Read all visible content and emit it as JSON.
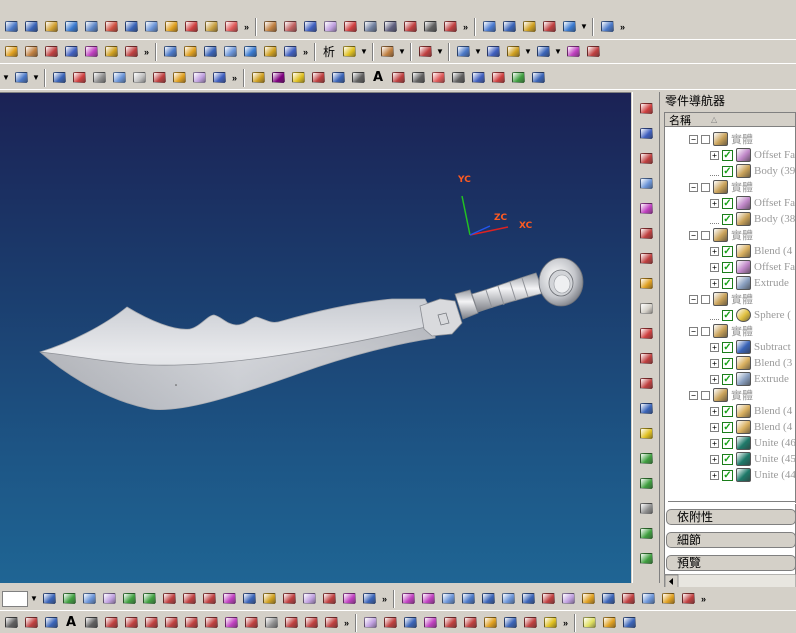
{
  "toolbars": {
    "row1": [
      {
        "name": "solid-box-icon",
        "color": "#4a78c8"
      },
      {
        "name": "cylinder-icon",
        "color": "#3a64b8"
      },
      {
        "name": "cone-icon",
        "color": "#d2a030"
      },
      {
        "name": "sphere-icon",
        "color": "#3a7ad0"
      },
      {
        "name": "block-icon",
        "color": "#5c86c8"
      },
      {
        "name": "extrude-icon",
        "color": "#d05040"
      },
      {
        "name": "revolve-icon",
        "color": "#3a64b8"
      },
      {
        "name": "sweep-icon",
        "color": "#6a94d8"
      },
      {
        "name": "tube-icon",
        "color": "#e0a020"
      },
      {
        "name": "hole-icon",
        "color": "#d04040"
      },
      {
        "name": "boss-icon",
        "color": "#c8a040"
      },
      {
        "name": "pocket-icon",
        "color": "#e05858"
      },
      {
        "name": "more-icon",
        "kind": "more"
      },
      {
        "name": "sep",
        "kind": "sep"
      },
      {
        "name": "blend-icon",
        "color": "#c08040"
      },
      {
        "name": "chamfer-icon",
        "color": "#c06060"
      },
      {
        "name": "shell-icon",
        "color": "#4060c0"
      },
      {
        "name": "offset-face-icon",
        "color": "#c0a0e0"
      },
      {
        "name": "draft-icon",
        "color": "#d04040"
      },
      {
        "name": "curve-icon",
        "color": "#7080a0"
      },
      {
        "name": "spline-icon",
        "color": "#606080"
      },
      {
        "name": "line-icon",
        "color": "#c04040"
      },
      {
        "name": "arc-icon",
        "color": "#606060"
      },
      {
        "name": "trim-icon",
        "color": "#c04040"
      },
      {
        "name": "more-icon",
        "kind": "more"
      },
      {
        "name": "sep",
        "kind": "sep"
      },
      {
        "name": "view-fit-icon",
        "color": "#4a7ad0"
      },
      {
        "name": "zoom-icon",
        "color": "#3a64b8"
      },
      {
        "name": "rotate-icon",
        "color": "#d0a020"
      },
      {
        "name": "pan-icon",
        "color": "#c04040"
      },
      {
        "name": "shaded-icon",
        "color": "#3a7ad0"
      },
      {
        "name": "dropdown",
        "kind": "drop"
      },
      {
        "name": "sep",
        "kind": "sep"
      },
      {
        "name": "analysis-icon",
        "color": "#4a78c8"
      },
      {
        "name": "more-icon",
        "kind": "more"
      }
    ],
    "row2": [
      {
        "name": "point-icon",
        "color": "#e0a020"
      },
      {
        "name": "plane-icon",
        "color": "#c08040"
      },
      {
        "name": "axis-icon",
        "color": "#c04040"
      },
      {
        "name": "csys-icon",
        "color": "#4060c0"
      },
      {
        "name": "sketch-icon",
        "color": "#c040c0"
      },
      {
        "name": "pattern-icon",
        "color": "#d0a020"
      },
      {
        "name": "mirror-icon",
        "color": "#c04040"
      },
      {
        "name": "more-icon",
        "kind": "more"
      },
      {
        "name": "sep",
        "kind": "sep"
      },
      {
        "name": "edit-feature-icon",
        "color": "#4a78c8"
      },
      {
        "name": "edit-param-icon",
        "color": "#e0a020"
      },
      {
        "name": "move-icon",
        "color": "#3a64b8"
      },
      {
        "name": "replace-icon",
        "color": "#6a94d8"
      },
      {
        "name": "suppress-icon",
        "color": "#3a7ad0"
      },
      {
        "name": "unsuppress-icon",
        "color": "#d0a020"
      },
      {
        "name": "reorder-icon",
        "color": "#4060c0"
      },
      {
        "name": "more-icon",
        "kind": "more"
      },
      {
        "name": "sep",
        "kind": "sep"
      },
      {
        "name": "analysis-label",
        "kind": "label",
        "bind": "toolbars.row2_label"
      },
      {
        "name": "measure-icon",
        "color": "#e0c020"
      },
      {
        "name": "dropdown",
        "kind": "drop"
      },
      {
        "name": "sep",
        "kind": "sep"
      },
      {
        "name": "section-icon",
        "color": "#c08040"
      },
      {
        "name": "dropdown",
        "kind": "drop"
      },
      {
        "name": "sep",
        "kind": "sep"
      },
      {
        "name": "layer-icon",
        "color": "#c04040"
      },
      {
        "name": "dropdown",
        "kind": "drop"
      },
      {
        "name": "sep",
        "kind": "sep"
      },
      {
        "name": "wcs-icon",
        "color": "#4a78c8"
      },
      {
        "name": "dropdown",
        "kind": "drop"
      },
      {
        "name": "grid-icon",
        "color": "#4060c0"
      },
      {
        "name": "snap-icon",
        "color": "#d0a020"
      },
      {
        "name": "dropdown",
        "kind": "drop"
      },
      {
        "name": "view-icon",
        "color": "#3a64b8"
      },
      {
        "name": "dropdown",
        "kind": "drop"
      },
      {
        "name": "orient-icon",
        "color": "#c040c0"
      },
      {
        "name": "select-icon",
        "color": "#c04040"
      }
    ],
    "row2_label": "析",
    "row3": [
      {
        "name": "dropdown",
        "kind": "drop"
      },
      {
        "name": "feature-icon",
        "color": "#4a78c8"
      },
      {
        "name": "dropdown",
        "kind": "drop"
      },
      {
        "name": "sep",
        "kind": "sep"
      },
      {
        "name": "library-icon",
        "color": "#3a64b8"
      },
      {
        "name": "part-icon",
        "color": "#d04040"
      },
      {
        "name": "gear-icon",
        "color": "#909090"
      },
      {
        "name": "template-icon",
        "color": "#6a94d8"
      },
      {
        "name": "sheet-icon",
        "color": "#c0c0c0"
      },
      {
        "name": "assembly-icon",
        "color": "#c04040"
      },
      {
        "name": "surface-icon",
        "color": "#e0a020"
      },
      {
        "name": "mesh-icon",
        "color": "#c0a0e0"
      },
      {
        "name": "render-icon",
        "color": "#4060c0"
      },
      {
        "name": "more-icon",
        "kind": "more"
      },
      {
        "name": "sep",
        "kind": "sep"
      },
      {
        "name": "dialog-icon",
        "color": "#d0a020"
      },
      {
        "name": "stop-icon",
        "color": "#800080"
      },
      {
        "name": "warning-icon",
        "color": "#e0c020"
      },
      {
        "name": "publish-icon",
        "color": "#c04040"
      },
      {
        "name": "data-icon",
        "color": "#3a64b8"
      },
      {
        "name": "param-icon",
        "color": "#606060"
      },
      {
        "name": "text-a-icon",
        "kind": "text",
        "bind": "toolbars.row3_text"
      },
      {
        "name": "text-style-icon",
        "color": "#c04040"
      },
      {
        "name": "dimension-icon",
        "color": "#606060"
      },
      {
        "name": "note-icon",
        "color": "#e05858"
      },
      {
        "name": "label-icon",
        "color": "#606060"
      },
      {
        "name": "table-icon",
        "color": "#4060c0"
      },
      {
        "name": "check-icon",
        "color": "#d04040"
      },
      {
        "name": "image-icon",
        "color": "#40a040"
      },
      {
        "name": "check2-icon",
        "color": "#3a64b8"
      }
    ],
    "row3_text": "A"
  },
  "viewport": {
    "background_top": "#1b2255",
    "background_bottom": "#1f6594",
    "axis_labels": {
      "y": "YC",
      "z": "ZC",
      "x": "XC"
    }
  },
  "resource_bar": [
    {
      "name": "sketch-resource-icon",
      "color": "#d04040"
    },
    {
      "name": "datum-resource-icon",
      "color": "#4060c0"
    },
    {
      "name": "pmi-resource-icon",
      "color": "#c04040"
    },
    {
      "name": "blend-resource-icon",
      "color": "#6a94d8"
    },
    {
      "name": "curve-resource-icon",
      "color": "#c040c0"
    },
    {
      "name": "table-resource-icon",
      "color": "#c04040"
    },
    {
      "name": "feature-resource-icon",
      "color": "#c04040"
    },
    {
      "name": "palette-resource-icon",
      "color": "#e0a020"
    },
    {
      "name": "blank-resource-icon",
      "color": "#d4d0c8"
    },
    {
      "name": "roles-resource-icon",
      "color": "#d04040"
    },
    {
      "name": "history-resource-icon",
      "color": "#c04040"
    },
    {
      "name": "constraint-resource-icon",
      "color": "#c04040"
    },
    {
      "name": "web-resource-icon",
      "color": "#3a64b8"
    },
    {
      "name": "reuse-resource-icon",
      "color": "#e0c020"
    },
    {
      "name": "library-resource-icon",
      "color": "#40a040"
    },
    {
      "name": "system-resource-icon",
      "color": "#40a040"
    },
    {
      "name": "print-resource-icon",
      "color": "#909090"
    },
    {
      "name": "back-resource-icon",
      "color": "#40a040"
    },
    {
      "name": "forward-resource-icon",
      "color": "#40a040"
    }
  ],
  "navigator": {
    "title": "零件導航器",
    "column_name": "名稱",
    "sort_glyph": "△",
    "rows": [
      {
        "level": 0,
        "expander": "−",
        "checkbox": "empty",
        "icon": "solid",
        "label": "實體"
      },
      {
        "level": 1,
        "expander": "+",
        "checkbox": "check",
        "icon": "offset",
        "label": "Offset Fa"
      },
      {
        "level": 1,
        "expander": "line",
        "checkbox": "check",
        "icon": "body",
        "label": "Body (39"
      },
      {
        "level": 0,
        "expander": "−",
        "checkbox": "empty",
        "icon": "solid",
        "label": "實體"
      },
      {
        "level": 1,
        "expander": "+",
        "checkbox": "check",
        "icon": "offset",
        "label": "Offset Fa"
      },
      {
        "level": 1,
        "expander": "line",
        "checkbox": "check",
        "icon": "body",
        "label": "Body (38"
      },
      {
        "level": 0,
        "expander": "−",
        "checkbox": "empty",
        "icon": "solid",
        "label": "實體"
      },
      {
        "level": 1,
        "expander": "+",
        "checkbox": "check",
        "icon": "blend",
        "label": "Blend (4"
      },
      {
        "level": 1,
        "expander": "+",
        "checkbox": "check",
        "icon": "offset",
        "label": "Offset Fa"
      },
      {
        "level": 1,
        "expander": "+",
        "checkbox": "check",
        "icon": "extrude",
        "label": "Extrude"
      },
      {
        "level": 0,
        "expander": "−",
        "checkbox": "empty",
        "icon": "solid",
        "label": "實體"
      },
      {
        "level": 1,
        "expander": "line",
        "checkbox": "check",
        "icon": "sphere",
        "label": "Sphere ("
      },
      {
        "level": 0,
        "expander": "−",
        "checkbox": "empty",
        "icon": "solid",
        "label": "實體"
      },
      {
        "level": 1,
        "expander": "+",
        "checkbox": "check",
        "icon": "subtract",
        "label": "Subtract"
      },
      {
        "level": 1,
        "expander": "+",
        "checkbox": "check",
        "icon": "blend",
        "label": "Blend (3"
      },
      {
        "level": 1,
        "expander": "+",
        "checkbox": "check",
        "icon": "extrude",
        "label": "Extrude"
      },
      {
        "level": 0,
        "expander": "−",
        "checkbox": "empty",
        "icon": "solid",
        "label": "實體"
      },
      {
        "level": 1,
        "expander": "+",
        "checkbox": "check",
        "icon": "blend",
        "label": "Blend (4"
      },
      {
        "level": 1,
        "expander": "+",
        "checkbox": "check",
        "icon": "blend",
        "label": "Blend (4"
      },
      {
        "level": 1,
        "expander": "+",
        "checkbox": "check",
        "icon": "unite",
        "label": "Unite (46"
      },
      {
        "level": 1,
        "expander": "+",
        "checkbox": "check",
        "icon": "unite",
        "label": "Unite (45"
      },
      {
        "level": 1,
        "expander": "+",
        "checkbox": "check",
        "icon": "unite",
        "label": "Unite (44"
      }
    ],
    "panels": [
      {
        "name": "dependencies-panel",
        "label": "依附性"
      },
      {
        "name": "details-panel",
        "label": "細節"
      },
      {
        "name": "preview-panel",
        "label": "預覽"
      }
    ]
  },
  "bottom_bar1": [
    {
      "name": "layer-select-dropdown",
      "kind": "drop"
    },
    {
      "name": "copy-icon",
      "color": "#3a64b8"
    },
    {
      "name": "layer-settings-icon",
      "color": "#40a040"
    },
    {
      "name": "visible-icon",
      "color": "#6a94d8"
    },
    {
      "name": "move-layer-icon",
      "color": "#c0a0e0"
    },
    {
      "name": "prev-icon",
      "color": "#40a040"
    },
    {
      "name": "next-icon",
      "color": "#40a040"
    },
    {
      "name": "select-filter-icon",
      "color": "#c04040"
    },
    {
      "name": "snap-point-icon",
      "color": "#c04040"
    },
    {
      "name": "snap-end-icon",
      "color": "#c04040"
    },
    {
      "name": "snap-mid-icon",
      "color": "#c040c0"
    },
    {
      "name": "snap-center-icon",
      "color": "#3a64b8"
    },
    {
      "name": "snap-quad-icon",
      "color": "#d0a020"
    },
    {
      "name": "snap-intersect-icon",
      "color": "#c04040"
    },
    {
      "name": "snap-face-icon",
      "color": "#c0a0e0"
    },
    {
      "name": "snap-curve-icon",
      "color": "#c04040"
    },
    {
      "name": "snap-existing-icon",
      "color": "#c040c0"
    },
    {
      "name": "snap-tangent-icon",
      "color": "#3a64b8"
    },
    {
      "name": "more-icon",
      "kind": "more"
    },
    {
      "name": "sep",
      "kind": "sep"
    },
    {
      "name": "wire-icon",
      "color": "#c040c0"
    },
    {
      "name": "hidden-icon",
      "color": "#c040c0"
    },
    {
      "name": "edge-icon",
      "color": "#6a94d8"
    },
    {
      "name": "face-icon",
      "color": "#4a78c8"
    },
    {
      "name": "face-analysis-icon",
      "color": "#3a64b8"
    },
    {
      "name": "smooth-icon",
      "color": "#6a94d8"
    },
    {
      "name": "partial-icon",
      "color": "#3a64b8"
    },
    {
      "name": "studio-icon",
      "color": "#c04040"
    },
    {
      "name": "lights-icon",
      "color": "#c0a0e0"
    },
    {
      "name": "materials-icon",
      "color": "#e0a020"
    },
    {
      "name": "pen-icon",
      "color": "#3a64b8"
    },
    {
      "name": "textures-icon",
      "color": "#c04040"
    },
    {
      "name": "background-icon",
      "color": "#6a94d8"
    },
    {
      "name": "env-icon",
      "color": "#e0a020"
    },
    {
      "name": "scene-icon",
      "color": "#c04040"
    },
    {
      "name": "more-icon",
      "kind": "more"
    }
  ],
  "bottom_bar2": [
    {
      "name": "sketch-curve-icon",
      "color": "#606060"
    },
    {
      "name": "profile-icon",
      "color": "#c04040"
    },
    {
      "name": "line-draw-icon",
      "color": "#3a64b8"
    },
    {
      "name": "text-a-icon",
      "kind": "text",
      "bind": "bottom_text"
    },
    {
      "name": "dim-icon",
      "color": "#606060"
    },
    {
      "name": "ellipse-icon",
      "color": "#c04040"
    },
    {
      "name": "point-set-icon",
      "color": "#c04040"
    },
    {
      "name": "spline-draw-icon",
      "color": "#c04040"
    },
    {
      "name": "rect-icon",
      "color": "#c04040"
    },
    {
      "name": "circle-icon",
      "color": "#c04040"
    },
    {
      "name": "polygon-icon",
      "color": "#c04040"
    },
    {
      "name": "conic-icon",
      "color": "#c040c0"
    },
    {
      "name": "arc-draw-icon",
      "color": "#c04040"
    },
    {
      "name": "helix-icon",
      "color": "#909090"
    },
    {
      "name": "xyz-icon",
      "color": "#c04040"
    },
    {
      "name": "offset-curve-icon",
      "color": "#c04040"
    },
    {
      "name": "project-icon",
      "color": "#c04040"
    },
    {
      "name": "more-icon",
      "kind": "more"
    },
    {
      "name": "sep",
      "kind": "sep"
    },
    {
      "name": "edit-curve-icon",
      "color": "#c0a0e0"
    },
    {
      "name": "trim-curve-icon",
      "color": "#c04040"
    },
    {
      "name": "split-curve-icon",
      "color": "#3a64b8"
    },
    {
      "name": "fillet-curve-icon",
      "color": "#c040c0"
    },
    {
      "name": "join-curve-icon",
      "color": "#c04040"
    },
    {
      "name": "extend-curve-icon",
      "color": "#c04040"
    },
    {
      "name": "length-icon",
      "color": "#e0a020"
    },
    {
      "name": "smooth-curve-icon",
      "color": "#3a64b8"
    },
    {
      "name": "bridge-icon",
      "color": "#c04040"
    },
    {
      "name": "simplify-icon",
      "color": "#e0c020"
    },
    {
      "name": "more-icon",
      "kind": "more"
    },
    {
      "name": "sep",
      "kind": "sep"
    },
    {
      "name": "lightbulb-icon",
      "color": "#e0e060"
    },
    {
      "name": "settings-icon",
      "color": "#e0a020"
    },
    {
      "name": "tools-icon",
      "color": "#3a64b8"
    }
  ],
  "bottom_text": "A"
}
